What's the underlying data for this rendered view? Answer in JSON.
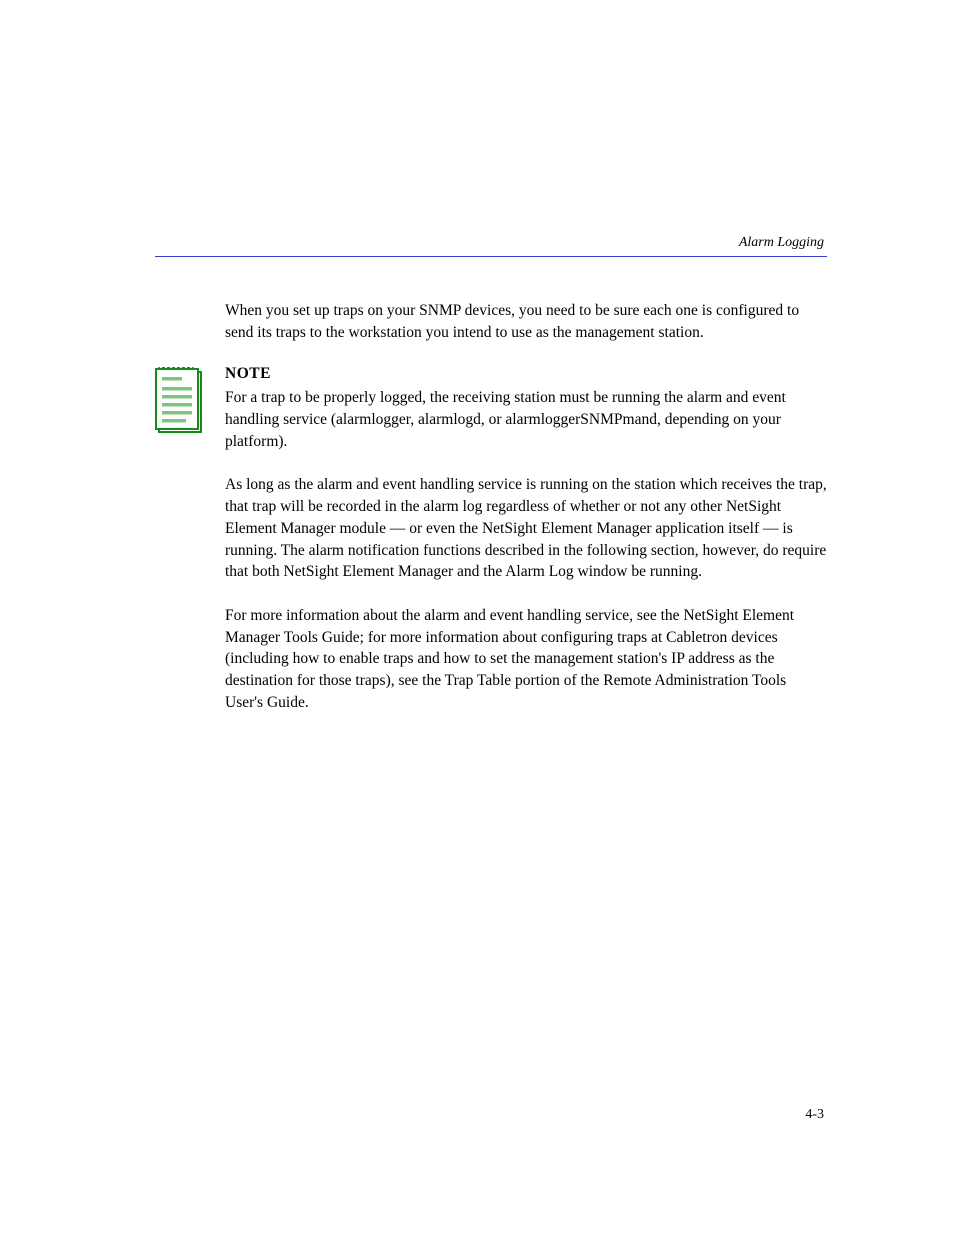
{
  "header": {
    "running_title": "Alarm Logging"
  },
  "content": {
    "paragraph1": "When you set up traps on your SNMP devices, you need to be sure each one is configured to send its traps to the workstation you intend to use as the management station.",
    "note": {
      "label": "NOTE",
      "body": "For a trap to be properly logged, the receiving station must be running the alarm and event handling service (alarmlogger, alarmlogd, or alarmloggerSNMPmand, depending on your platform)."
    },
    "paragraph2": "As long as the alarm and event handling service is running on the station which receives the trap, that trap will be recorded in the alarm log regardless of whether or not any other NetSight Element Manager module — or even the NetSight Element Manager application itself — is running. The alarm notification functions described in the following section, however, do require that both NetSight Element Manager and the Alarm Log window be running.",
    "paragraph3": "For more information about the alarm and event handling service, see the NetSight Element Manager Tools Guide; for more information about configuring traps at Cabletron devices (including how to enable traps and how to set the management station's IP address as the destination for those traps), see the Trap Table portion of the Remote Administration Tools User's Guide."
  },
  "footer": {
    "page_number": "4-3"
  }
}
